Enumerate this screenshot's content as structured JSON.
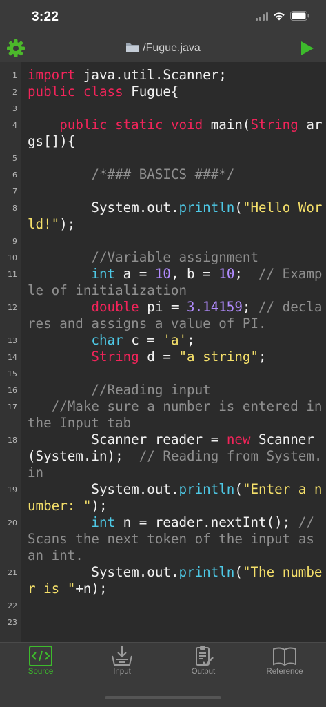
{
  "status_bar": {
    "time": "3:22"
  },
  "header": {
    "title": "/Fugue.java",
    "icons": {
      "settings": "gear-icon",
      "file": "folder-icon",
      "run": "play-icon"
    },
    "colors": {
      "gear": "#4cb82b",
      "run": "#3dbb2c"
    }
  },
  "editor": {
    "lines": [
      {
        "number": "1",
        "tokens": [
          {
            "t": "import",
            "c": "keyword"
          },
          {
            "t": " java.util.Scanner;",
            "c": "plain"
          }
        ]
      },
      {
        "number": "2",
        "tokens": [
          {
            "t": "public class",
            "c": "keyword"
          },
          {
            "t": " Fugue{",
            "c": "plain"
          }
        ]
      },
      {
        "number": "3",
        "tokens": [
          {
            "t": "",
            "c": "plain"
          }
        ]
      },
      {
        "number": "4",
        "tokens": [
          {
            "t": "    ",
            "c": "plain"
          },
          {
            "t": "public static void",
            "c": "keyword"
          },
          {
            "t": " main(",
            "c": "plain"
          },
          {
            "t": "String",
            "c": "keyword"
          },
          {
            "t": " args[]){",
            "c": "plain"
          }
        ]
      },
      {
        "number": "5",
        "tokens": [
          {
            "t": "",
            "c": "plain"
          }
        ]
      },
      {
        "number": "6",
        "tokens": [
          {
            "t": "        /*### BASICS ###*/",
            "c": "comment"
          }
        ]
      },
      {
        "number": "7",
        "tokens": [
          {
            "t": "",
            "c": "plain"
          }
        ]
      },
      {
        "number": "8",
        "tokens": [
          {
            "t": "        System.out.",
            "c": "plain"
          },
          {
            "t": "println",
            "c": "method"
          },
          {
            "t": "(",
            "c": "plain"
          },
          {
            "t": "\"Hello World!\"",
            "c": "string"
          },
          {
            "t": ");",
            "c": "plain"
          }
        ]
      },
      {
        "number": "9",
        "tokens": [
          {
            "t": "",
            "c": "plain"
          }
        ]
      },
      {
        "number": "10",
        "tokens": [
          {
            "t": "        //Variable assignment",
            "c": "comment"
          }
        ]
      },
      {
        "number": "11",
        "tokens": [
          {
            "t": "        ",
            "c": "plain"
          },
          {
            "t": "int",
            "c": "type"
          },
          {
            "t": " a = ",
            "c": "plain"
          },
          {
            "t": "10",
            "c": "number"
          },
          {
            "t": ", b = ",
            "c": "plain"
          },
          {
            "t": "10",
            "c": "number"
          },
          {
            "t": ";  ",
            "c": "plain"
          },
          {
            "t": "// Example of initialization",
            "c": "comment"
          }
        ]
      },
      {
        "number": "12",
        "tokens": [
          {
            "t": "        ",
            "c": "plain"
          },
          {
            "t": "double",
            "c": "keyword"
          },
          {
            "t": " pi = ",
            "c": "plain"
          },
          {
            "t": "3.14159",
            "c": "number"
          },
          {
            "t": "; ",
            "c": "plain"
          },
          {
            "t": "// declares and assigns a value of PI.",
            "c": "comment"
          }
        ]
      },
      {
        "number": "13",
        "tokens": [
          {
            "t": "        ",
            "c": "plain"
          },
          {
            "t": "char",
            "c": "type"
          },
          {
            "t": " c = ",
            "c": "plain"
          },
          {
            "t": "'a'",
            "c": "string"
          },
          {
            "t": ";",
            "c": "plain"
          }
        ]
      },
      {
        "number": "14",
        "tokens": [
          {
            "t": "        ",
            "c": "plain"
          },
          {
            "t": "String",
            "c": "keyword"
          },
          {
            "t": " d = ",
            "c": "plain"
          },
          {
            "t": "\"a string\"",
            "c": "string"
          },
          {
            "t": ";",
            "c": "plain"
          }
        ]
      },
      {
        "number": "15",
        "tokens": [
          {
            "t": "",
            "c": "plain"
          }
        ]
      },
      {
        "number": "16",
        "tokens": [
          {
            "t": "        //Reading input",
            "c": "comment"
          }
        ]
      },
      {
        "number": "17",
        "tokens": [
          {
            "t": "   //Make sure a number is entered in the Input tab",
            "c": "comment"
          }
        ]
      },
      {
        "number": "18",
        "tokens": [
          {
            "t": "        Scanner reader = ",
            "c": "plain"
          },
          {
            "t": "new",
            "c": "keyword"
          },
          {
            "t": " Scanner(System.in);  ",
            "c": "plain"
          },
          {
            "t": "// Reading from System.in",
            "c": "comment"
          }
        ]
      },
      {
        "number": "19",
        "tokens": [
          {
            "t": "        System.out.",
            "c": "plain"
          },
          {
            "t": "println",
            "c": "method"
          },
          {
            "t": "(",
            "c": "plain"
          },
          {
            "t": "\"Enter a number: \"",
            "c": "string"
          },
          {
            "t": ");",
            "c": "plain"
          }
        ]
      },
      {
        "number": "20",
        "tokens": [
          {
            "t": "        ",
            "c": "plain"
          },
          {
            "t": "int",
            "c": "type"
          },
          {
            "t": " n = reader.nextInt(); ",
            "c": "plain"
          },
          {
            "t": "// Scans the next token of the input as an int.",
            "c": "comment"
          }
        ]
      },
      {
        "number": "21",
        "tokens": [
          {
            "t": "        System.out.",
            "c": "plain"
          },
          {
            "t": "println",
            "c": "method"
          },
          {
            "t": "(",
            "c": "plain"
          },
          {
            "t": "\"The number is \"",
            "c": "string"
          },
          {
            "t": "+n);",
            "c": "plain"
          }
        ]
      },
      {
        "number": "22",
        "tokens": [
          {
            "t": "",
            "c": "plain"
          }
        ]
      },
      {
        "number": "23",
        "tokens": [
          {
            "t": "",
            "c": "plain"
          }
        ]
      }
    ]
  },
  "tabs": [
    {
      "label": "Source",
      "icon": "source-code-icon",
      "active": true
    },
    {
      "label": "Input",
      "icon": "input-tray-icon",
      "active": false
    },
    {
      "label": "Output",
      "icon": "output-clipboard-icon",
      "active": false
    },
    {
      "label": "Reference",
      "icon": "book-icon",
      "active": false
    }
  ]
}
